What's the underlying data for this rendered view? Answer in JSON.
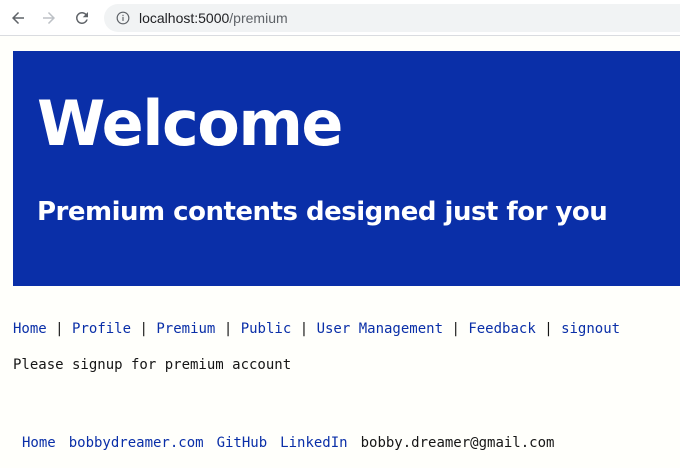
{
  "browser": {
    "url_host": "localhost:5000",
    "url_path": "/premium",
    "icons": {
      "back": "arrow-left-icon",
      "forward": "arrow-right-icon",
      "reload": "reload-icon",
      "info": "info-icon"
    }
  },
  "hero": {
    "title": "Welcome",
    "subtitle": "Premium contents designed just for you",
    "background": "#0a2fa8"
  },
  "nav": {
    "items": [
      {
        "label": "Home"
      },
      {
        "label": "Profile"
      },
      {
        "label": "Premium"
      },
      {
        "label": "Public"
      },
      {
        "label": "User Management"
      },
      {
        "label": "Feedback"
      },
      {
        "label": "signout"
      }
    ],
    "separator": "|"
  },
  "message": "Please signup for premium account",
  "footer": {
    "links": [
      {
        "label": "Home"
      },
      {
        "label": "bobbydreamer.com"
      },
      {
        "label": "GitHub"
      },
      {
        "label": "LinkedIn"
      }
    ],
    "email": "bobby.dreamer@gmail.com"
  },
  "colors": {
    "link": "#0a2fa8",
    "text": "#161616",
    "page_bg": "#fffffb"
  }
}
